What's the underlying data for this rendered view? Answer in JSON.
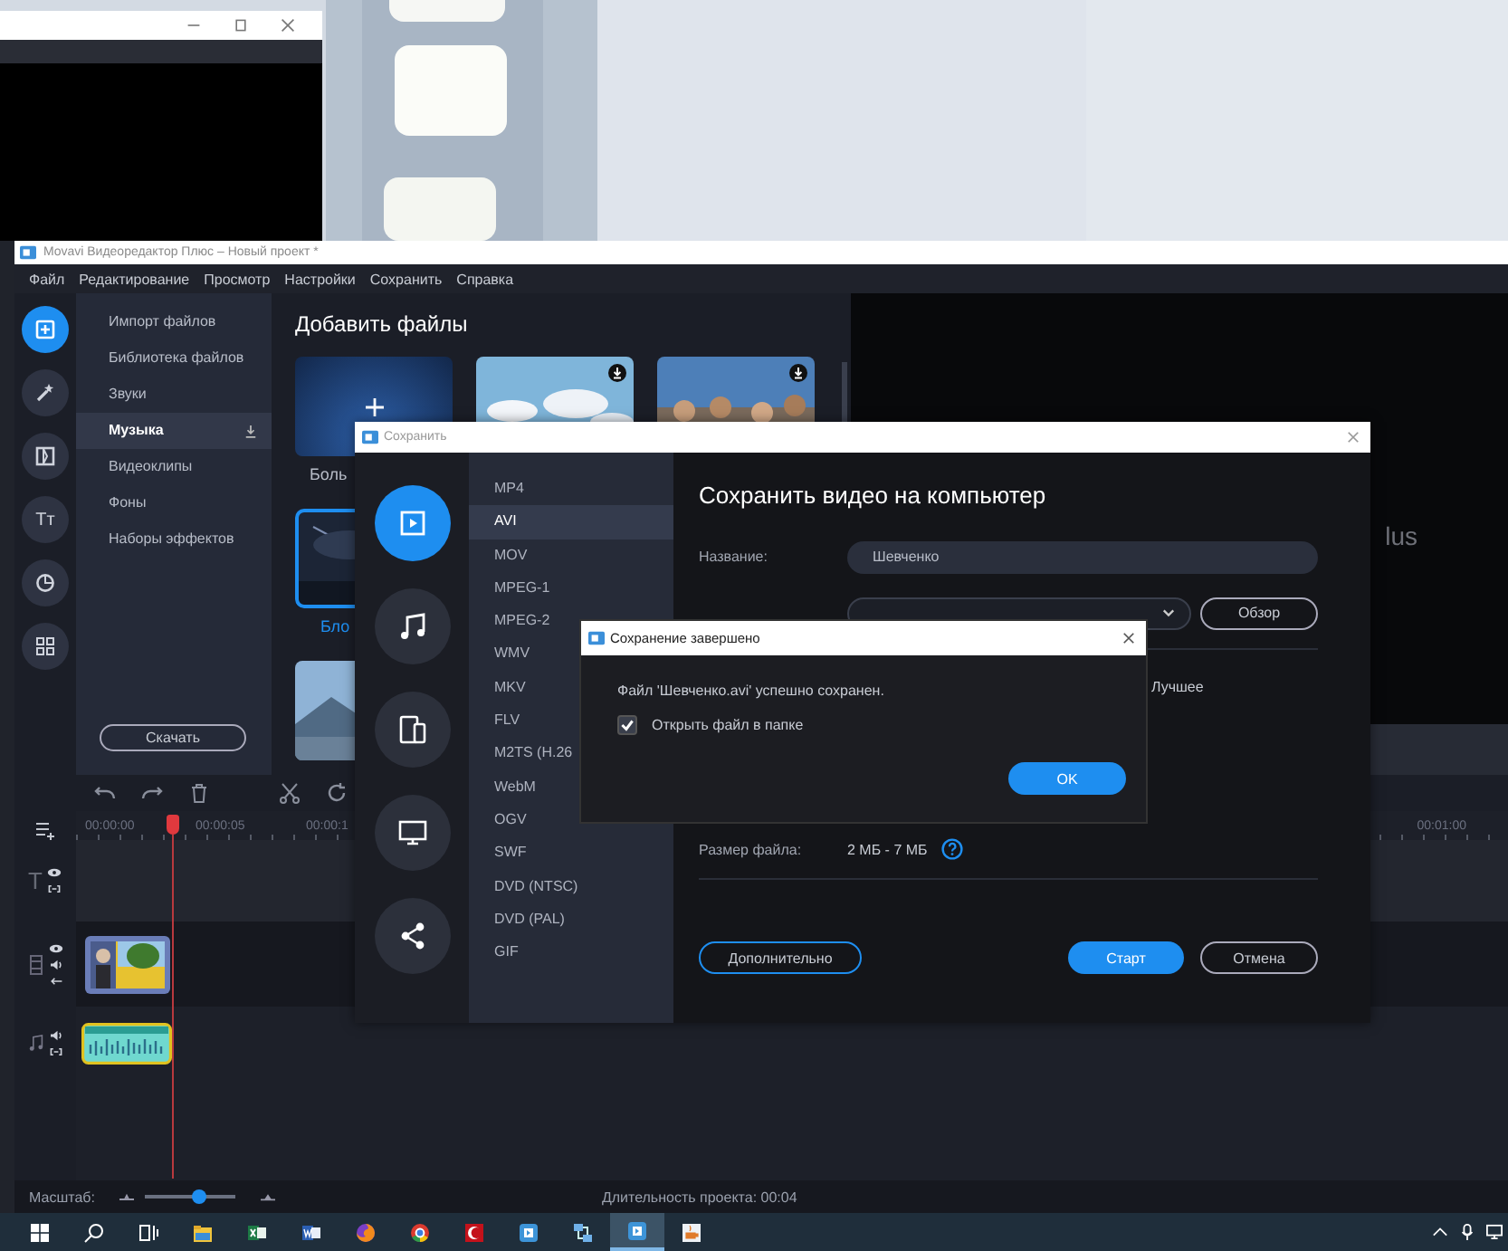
{
  "main_window": {
    "title": "Movavi Видеоредактор Плюс – Новый проект *",
    "menu": [
      "Файл",
      "Редактирование",
      "Просмотр",
      "Настройки",
      "Сохранить",
      "Справка"
    ],
    "tools": [
      {
        "kind": "import",
        "selected": true
      },
      {
        "kind": "magic",
        "selected": false
      },
      {
        "kind": "transitions",
        "selected": false
      },
      {
        "kind": "titles",
        "glyph": "Tт",
        "selected": false
      },
      {
        "kind": "stickers",
        "selected": false
      },
      {
        "kind": "more",
        "selected": false
      }
    ],
    "categories": [
      {
        "label": "Импорт файлов",
        "selected": false
      },
      {
        "label": "Библиотека файлов",
        "selected": false
      },
      {
        "label": "Звуки",
        "selected": false
      },
      {
        "label": "Музыка",
        "selected": true
      },
      {
        "label": "Видеоклипы",
        "selected": false
      },
      {
        "label": "Фоны",
        "selected": false
      },
      {
        "label": "Наборы эффектов",
        "selected": false
      }
    ],
    "download_button": "Скачать",
    "add_files": {
      "title": "Добавить файлы",
      "tiles": [
        {
          "kind": "add",
          "label": "Боль",
          "selected": false
        },
        {
          "kind": "clouds",
          "selected": false
        },
        {
          "kind": "crowd",
          "selected": false
        },
        {
          "kind": "storm",
          "label": "Бло",
          "selected": true
        },
        {
          "kind": "landscape",
          "selected": false
        }
      ]
    },
    "preview": {
      "text": "lus"
    },
    "timeline": {
      "ruler": [
        "00:00:00",
        "00:00:05",
        "00:00:1"
      ],
      "ruler_end": "00:01:00",
      "tracks": [
        {
          "kind": "text",
          "glyph": "T"
        },
        {
          "kind": "video"
        },
        {
          "kind": "audio"
        }
      ],
      "zoom_label": "Масштаб:",
      "zoom": {
        "level": 0.6
      },
      "duration": "Длительность проекта: 00:04"
    }
  },
  "save_dialog": {
    "title": "Сохранить",
    "categories": [
      {
        "kind": "video",
        "selected": true
      },
      {
        "kind": "music",
        "selected": false
      },
      {
        "kind": "devices",
        "selected": false
      },
      {
        "kind": "tv",
        "selected": false
      },
      {
        "kind": "share",
        "selected": false
      }
    ],
    "formats": [
      {
        "label": "MP4",
        "selected": false
      },
      {
        "label": "AVI",
        "selected": true
      },
      {
        "label": "MOV",
        "selected": false
      },
      {
        "label": "MPEG-1",
        "selected": false
      },
      {
        "label": "MPEG-2",
        "selected": false
      },
      {
        "label": "WMV",
        "selected": false
      },
      {
        "label": "MKV",
        "selected": false
      },
      {
        "label": "FLV",
        "selected": false
      },
      {
        "label": "M2TS (H.26",
        "selected": false
      },
      {
        "label": "WebM",
        "selected": false
      },
      {
        "label": "OGV",
        "selected": false
      },
      {
        "label": "SWF",
        "selected": false
      },
      {
        "label": "DVD (NTSC)",
        "selected": false
      },
      {
        "label": "DVD (PAL)",
        "selected": false
      },
      {
        "label": "GIF",
        "selected": false
      }
    ],
    "heading": "Сохранить видео на компьютер",
    "name_label": "Название:",
    "name_value": "Шевченко",
    "browse_button": "Обзор",
    "quality_value": "Лучшее",
    "size_label": "Размер файла:",
    "size_value": "2 МБ - 7 МБ",
    "more_button": "Дополнительно",
    "start_button": "Старт",
    "cancel_button": "Отмена"
  },
  "done_dialog": {
    "title": "Сохранение завершено",
    "message": "Файл 'Шевченко.avi' успешно сохранен.",
    "open_folder": {
      "label": "Открыть файл в папке",
      "checked": true
    },
    "ok_button": "OK"
  },
  "taskbar": {
    "apps": [
      {
        "kind": "start",
        "selected": false
      },
      {
        "kind": "search",
        "selected": false
      },
      {
        "kind": "taskview",
        "selected": false
      },
      {
        "kind": "folder",
        "selected": false
      },
      {
        "kind": "sheet",
        "selected": false
      },
      {
        "kind": "doc",
        "selected": false
      },
      {
        "kind": "fox",
        "selected": false
      },
      {
        "kind": "chrome",
        "selected": false
      },
      {
        "kind": "crescent",
        "selected": false
      },
      {
        "kind": "bluebox",
        "selected": false
      },
      {
        "kind": "network",
        "selected": false
      },
      {
        "kind": "bluebox",
        "selected": true
      },
      {
        "kind": "cup",
        "selected": false
      }
    ]
  }
}
